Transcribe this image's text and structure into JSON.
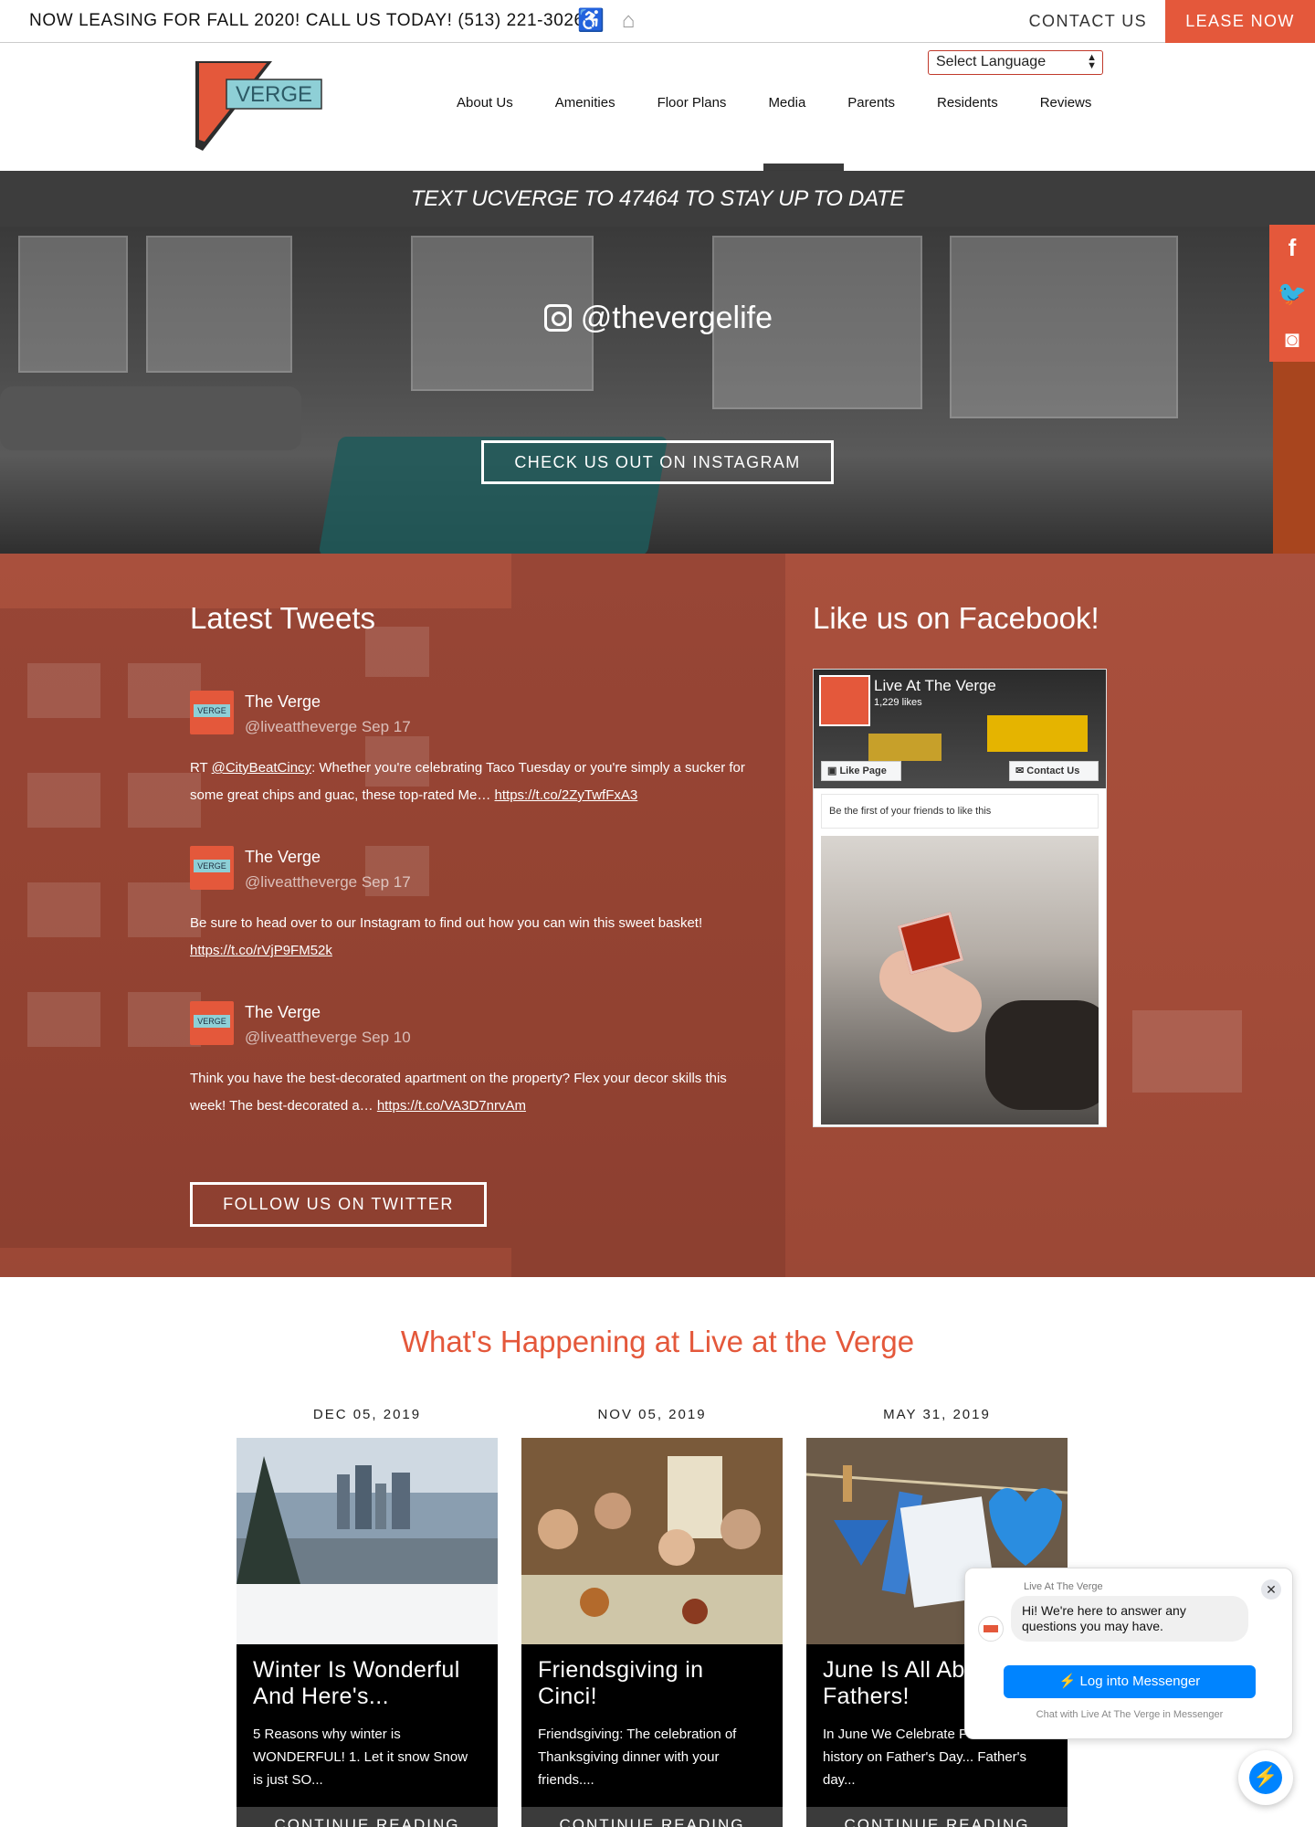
{
  "topbar": {
    "promo": "NOW LEASING FOR FALL 2020! CALL US TODAY! (513) 221-3026",
    "icons": [
      "accessibility-icon",
      "fair-housing-icon"
    ],
    "contact_label": "CONTACT US",
    "lease_label": "LEASE NOW"
  },
  "header": {
    "logo_text": "VERGE",
    "language_select": "Select Language",
    "nav": [
      "About Us",
      "Amenities",
      "Floor Plans",
      "Media",
      "Parents",
      "Residents",
      "Reviews"
    ]
  },
  "banner": {
    "text": "TEXT UCVERGE TO 47464 TO STAY UP TO DATE"
  },
  "instagram": {
    "handle": "@thevergelife",
    "button": "CHECK US OUT ON INSTAGRAM"
  },
  "social_tabs": [
    "facebook-icon",
    "twitter-icon",
    "instagram-icon"
  ],
  "tweets_section": {
    "title": "Latest Tweets",
    "tweets": [
      {
        "name": "The Verge",
        "handle": "@liveattheverge Sep 17",
        "text_prefix": "RT ",
        "mention": "@CityBeatCincy",
        "text": ": Whether you're celebrating Taco Tuesday or you're simply a sucker for some great chips and guac, these top-rated Me… ",
        "link": "https://t.co/2ZyTwfFxA3"
      },
      {
        "name": "The Verge",
        "handle": "@liveattheverge Sep 17",
        "text_prefix": "",
        "mention": "",
        "text": "Be sure to head over to our Instagram to find out how you can win this sweet basket! ",
        "link": "https://t.co/rVjP9FM52k"
      },
      {
        "name": "The Verge",
        "handle": "@liveattheverge Sep 10",
        "text_prefix": "",
        "mention": "",
        "text": "Think you have the best-decorated apartment on the property? Flex your decor skills this week! The best-decorated a… ",
        "link": "https://t.co/VA3D7nrvAm"
      }
    ],
    "avatar_text": "VERGE",
    "follow_button": "FOLLOW US ON TWITTER"
  },
  "facebook": {
    "title": "Like us on Facebook!",
    "page_name": "Live At The Verge",
    "likes": "1,229 likes",
    "like_button": "Like Page",
    "contact_button": "Contact Us",
    "friends_text": "Be the first of your friends to like this"
  },
  "happening": {
    "title": "What's Happening at Live at the Verge",
    "continue_label": "CONTINUE READING",
    "posts": [
      {
        "date": "DEC 05, 2019",
        "title": "Winter Is Wonderful And Here's...",
        "excerpt": "5 Reasons why winter is WONDERFUL!   1. Let it snow Snow is just SO..."
      },
      {
        "date": "NOV 05, 2019",
        "title": "Friendsgiving in Cinci!",
        "excerpt": "Friendsgiving: The celebration of Thanksgiving dinner with your friends...."
      },
      {
        "date": "MAY 31, 2019",
        "title": "June Is All About Fathers!",
        "excerpt": "In June We Celebrate Fathers! A little history on Father's Day... Father's day..."
      }
    ]
  },
  "messenger": {
    "page": "Live At The Verge",
    "message": "Hi! We're here to answer any questions you may have.",
    "login_button": "Log into Messenger",
    "footer": "Chat with Live At The Verge in Messenger",
    "close": "✕"
  }
}
